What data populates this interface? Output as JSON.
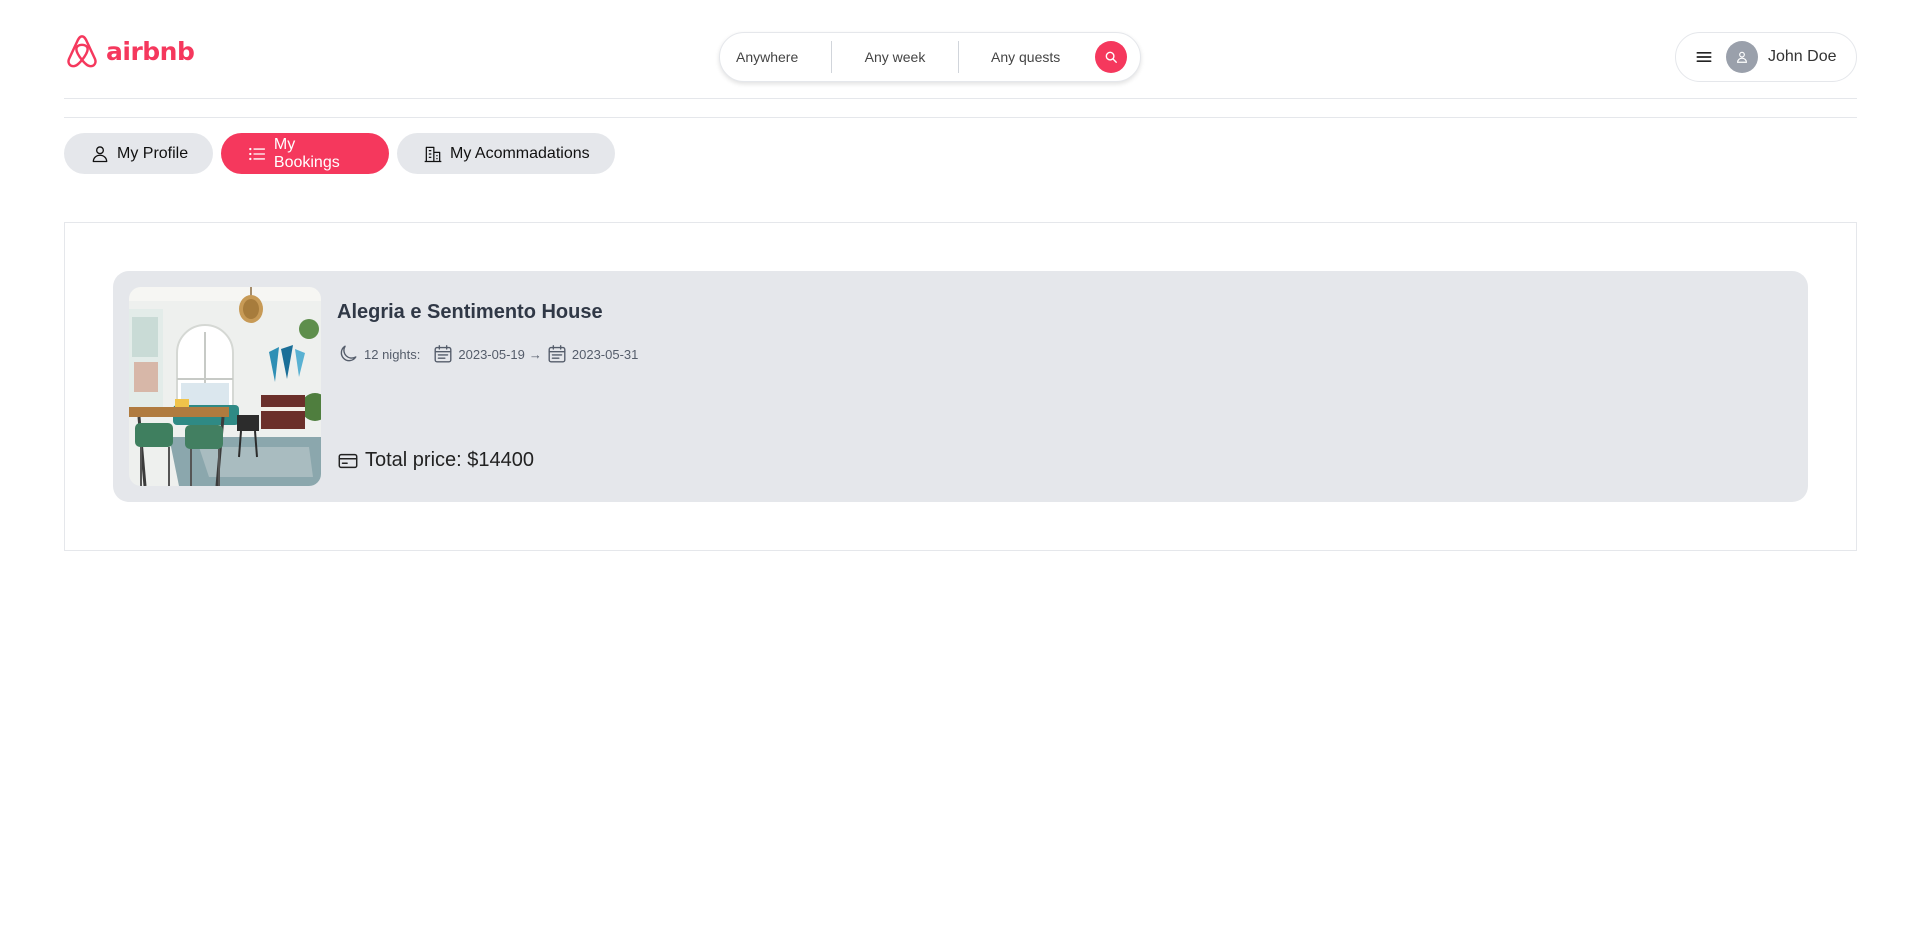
{
  "brand": {
    "name": "airbnb",
    "color": "#f5385d"
  },
  "search": {
    "where": "Anywhere",
    "when": "Any week",
    "who": "Any quests",
    "icon": "search-icon"
  },
  "user": {
    "name": "John Doe",
    "menu_icon": "hamburger-icon",
    "avatar_icon": "user-icon"
  },
  "tabs": [
    {
      "label": "My Profile",
      "icon": "user-icon",
      "active": false
    },
    {
      "label": "My Bookings",
      "icon": "list-icon",
      "active": true
    },
    {
      "label": "My Acommadations",
      "icon": "building-icon",
      "active": false
    }
  ],
  "bookings": [
    {
      "title": "Alegria e Sentimento House",
      "nights": "12 nights:",
      "check_in": "2023-05-19",
      "arrow": "→",
      "check_out": "2023-05-31",
      "price": "Total price: $14400",
      "icons": {
        "nights": "moon-icon",
        "dates": "calendar-icon",
        "price": "credit-card-icon"
      }
    }
  ],
  "colors": {
    "accent": "#f5385d",
    "card_bg": "#e5e7eb",
    "border": "#e5e7eb"
  }
}
